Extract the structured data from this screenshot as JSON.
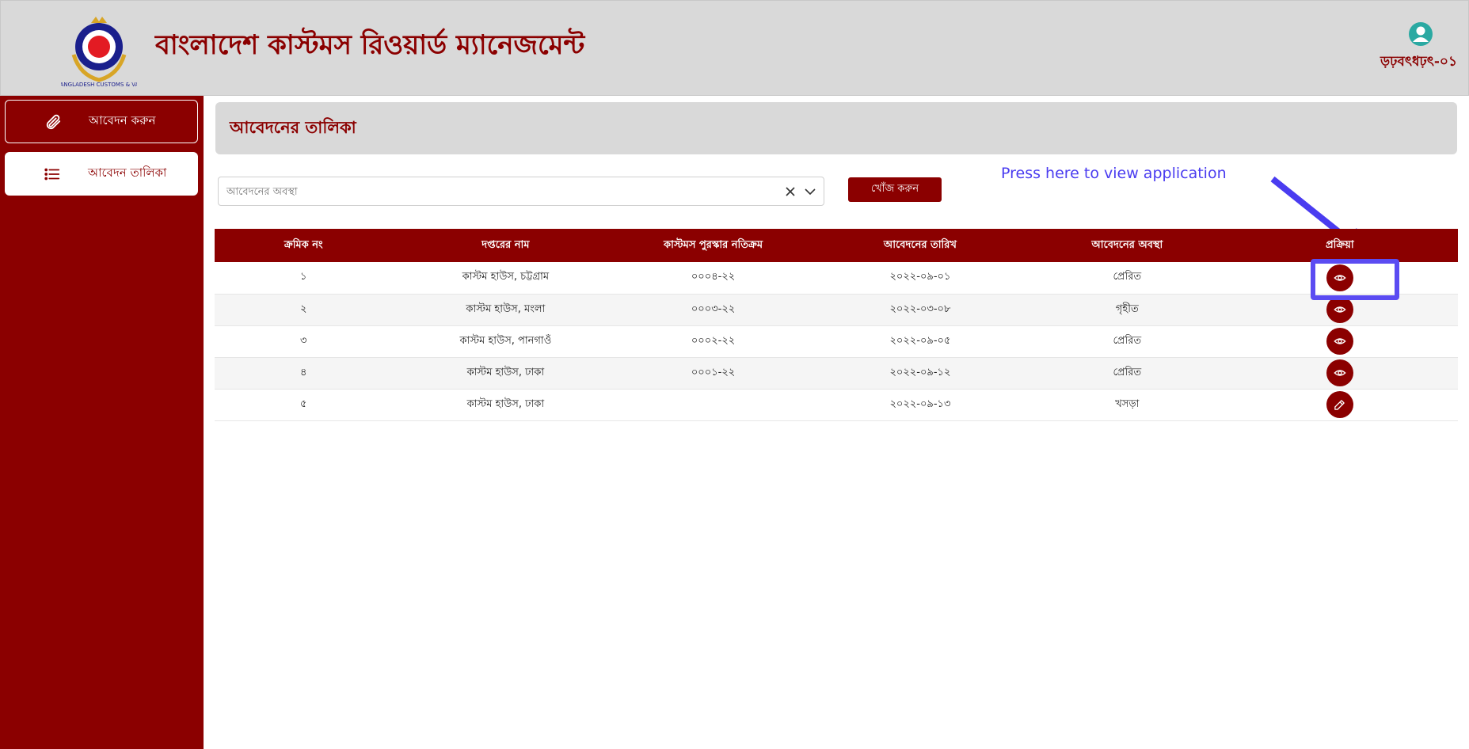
{
  "header": {
    "title": "বাংলাদেশ কাস্টমস রিওয়ার্ড ম্যানেজমেন্ট",
    "logo_text": "BANGLADESH CUSTOMS & VAT",
    "user_name": "ড়ঢ়বৎধঢ়ৎ-০১",
    "brand_color": "#8b0000"
  },
  "sidebar": {
    "items": [
      {
        "label": "আবেদন করুন",
        "icon": "paperclip-icon"
      },
      {
        "label": "আবেদন তালিকা",
        "icon": "list-icon"
      }
    ]
  },
  "page": {
    "title": "আবেদনের তালিকা"
  },
  "filter": {
    "placeholder": "আবেদনের অবস্থা",
    "search_label": "খোঁজ করুন"
  },
  "annotation": {
    "text": "Press here to view application",
    "color": "#4a3cf0"
  },
  "table": {
    "headers": [
      "ক্রমিক নং",
      "দপ্তরের নাম",
      "কাস্টমস পুরস্কার নতিক্রম",
      "আবেদনের তারিখ",
      "আবেদনের অবস্থা",
      "প্রক্রিয়া"
    ],
    "rows": [
      {
        "serial": "১",
        "office": "কাস্টম হাউস, চট্টগ্রাম",
        "reward_no": "০০০৪-২২",
        "date": "২০২২-০৯-০১",
        "status": "প্রেরিত",
        "action": "eye-icon"
      },
      {
        "serial": "২",
        "office": "কাস্টম হাউস, মংলা",
        "reward_no": "০০০৩-২২",
        "date": "২০২২-০৩-০৮",
        "status": "গৃহীত",
        "action": "eye-icon"
      },
      {
        "serial": "৩",
        "office": "কাস্টম হাউস, পানগাওঁ",
        "reward_no": "০০০২-২২",
        "date": "২০২২-০৯-০৫",
        "status": "প্রেরিত",
        "action": "eye-icon"
      },
      {
        "serial": "৪",
        "office": "কাস্টম হাউস, ঢাকা",
        "reward_no": "০০০১-২২",
        "date": "২০২২-০৯-১২",
        "status": "প্রেরিত",
        "action": "eye-icon"
      },
      {
        "serial": "৫",
        "office": "কাস্টম হাউস, ঢাকা",
        "reward_no": "",
        "date": "২০২২-০৯-১৩",
        "status": "খসড়া",
        "action": "pencil-icon"
      }
    ]
  }
}
